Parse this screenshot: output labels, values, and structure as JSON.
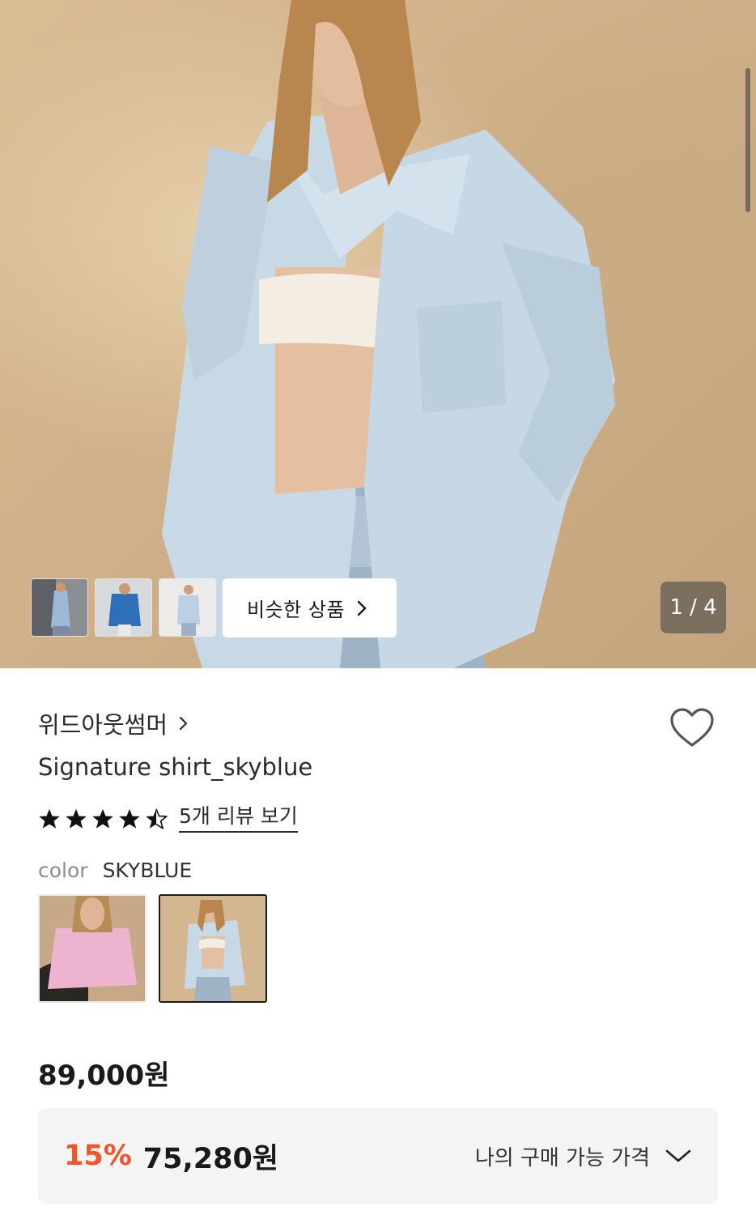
{
  "gallery": {
    "similar_label": "비슷한 상품",
    "counter": "1 / 4",
    "thumbnails": [
      "thumbnail-1",
      "thumbnail-2",
      "thumbnail-3"
    ]
  },
  "product": {
    "brand": "위드아웃썸머",
    "name": "Signature shirt_skyblue",
    "rating": 4.5,
    "rating_max": 5,
    "review_link": "5개 리뷰 보기",
    "color_label": "color",
    "color_value": "SKYBLUE",
    "color_options": [
      "pink",
      "skyblue"
    ],
    "price": "89,000원",
    "discount_percent": "15%",
    "discount_price": "75,280원",
    "my_price_label": "나의 구매 가능 가격"
  },
  "icons": {
    "heart": "heart-icon",
    "chevron": "chevron-right-icon",
    "expand": "chevron-down-icon",
    "star": "star-icon"
  },
  "colors": {
    "accent": "#f2552c",
    "text": "#1a1a1a",
    "muted": "#8c8c8c",
    "box_bg": "#f4f4f4"
  }
}
